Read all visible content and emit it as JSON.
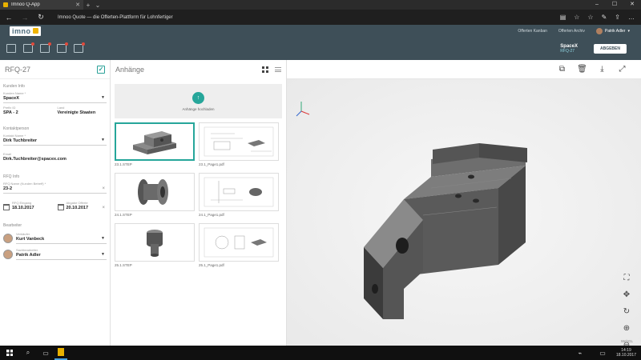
{
  "browser": {
    "tab_title": "Imnoo Q-App",
    "url": "Imnoo Quote — die Offerten-Plattform für Lohnfertiger"
  },
  "header": {
    "logo_text": "imno",
    "links": [
      "Offerten Kanban",
      "Offerten Archiv"
    ],
    "user_name": "Patrik Adler"
  },
  "subheader": {
    "project_name": "SpaceX",
    "project_code": "RFQ-27",
    "submit_label": "ABGEBEN"
  },
  "left": {
    "title": "RFQ-27",
    "customer": {
      "section": "Kunden Info",
      "name_label": "Kunden Name *",
      "name_value": "SpaceX",
      "prefix_label": "Prefix ID",
      "prefix_value": "SPA - 2",
      "country_label": "Land",
      "country_value": "Vereinigte Staaten"
    },
    "contact": {
      "section": "Kontaktperson",
      "name_label": "Kontakt Name *",
      "name_value": "Dirk Tuchbreiter",
      "email_label": "Email",
      "email_value": "Dirk.Tuchbreiter@spacex.com"
    },
    "rfq": {
      "section": "RFQ Info",
      "name_label": "RFQ Name (Kunden Betreff) *",
      "name_value": "23-2",
      "received_label": "RFQ Eingang",
      "received_value": "18.10.2017",
      "due_label": "Abgabe Offerte",
      "due_value": "20.10.2017"
    },
    "staff": {
      "section": "Bearbeiter",
      "seller_label": "Verkäufer",
      "seller_value": "Kurt Vanbeck",
      "tech_label": "Sachbearbeiter",
      "tech_value": "Patrik Adler"
    }
  },
  "attachments": {
    "title": "Anhänge",
    "upload_label": "Anhänge hochladen",
    "upload_icon": "↑",
    "files": [
      {
        "name": "23.1.STEP",
        "kind": "part-block",
        "selected": true
      },
      {
        "name": "23.1_Page1.pdf",
        "kind": "drawing"
      },
      {
        "name": "24.1.STEP",
        "kind": "part-spool"
      },
      {
        "name": "24.1_Page1.pdf",
        "kind": "drawing"
      },
      {
        "name": "25.1.STEP",
        "kind": "part-bolt"
      },
      {
        "name": "25.1_Page1.pdf",
        "kind": "drawing"
      }
    ]
  },
  "viewer": {
    "label": "WebGL"
  },
  "taskbar": {
    "time": "14:19",
    "date": "18.10.2017"
  },
  "colors": {
    "header": "#3e4f58",
    "accent": "#26a69a",
    "logo_accent": "#f0b400"
  }
}
